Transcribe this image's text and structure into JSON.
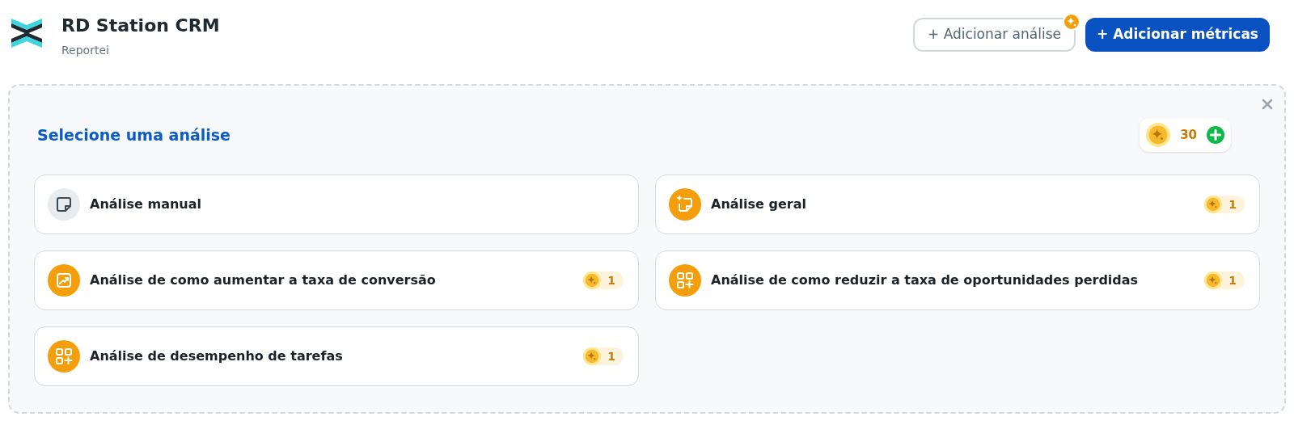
{
  "header": {
    "title": "RD Station CRM",
    "subtitle": "Reportei"
  },
  "buttons": [
    {
      "label": "+ Adicionar análise",
      "kind": "outline"
    },
    {
      "label": "+ Adicionar métricas",
      "kind": "primary"
    }
  ],
  "panel": {
    "title": "Selecione uma análise",
    "credits": "30",
    "options": [
      {
        "kind": "manual",
        "label": "Análise manual"
      },
      {
        "kind": "general",
        "label": "Análise geral",
        "cost": "1"
      },
      {
        "kind": "chart",
        "label": "Análise de como aumentar a taxa de conversão",
        "cost": "1"
      },
      {
        "kind": "grid",
        "label": "Análise de como reduzir a taxa de oportunidades perdidas",
        "cost": "1"
      },
      {
        "kind": "grid",
        "label": "Análise de desempenho de tarefas",
        "cost": "1"
      }
    ]
  }
}
